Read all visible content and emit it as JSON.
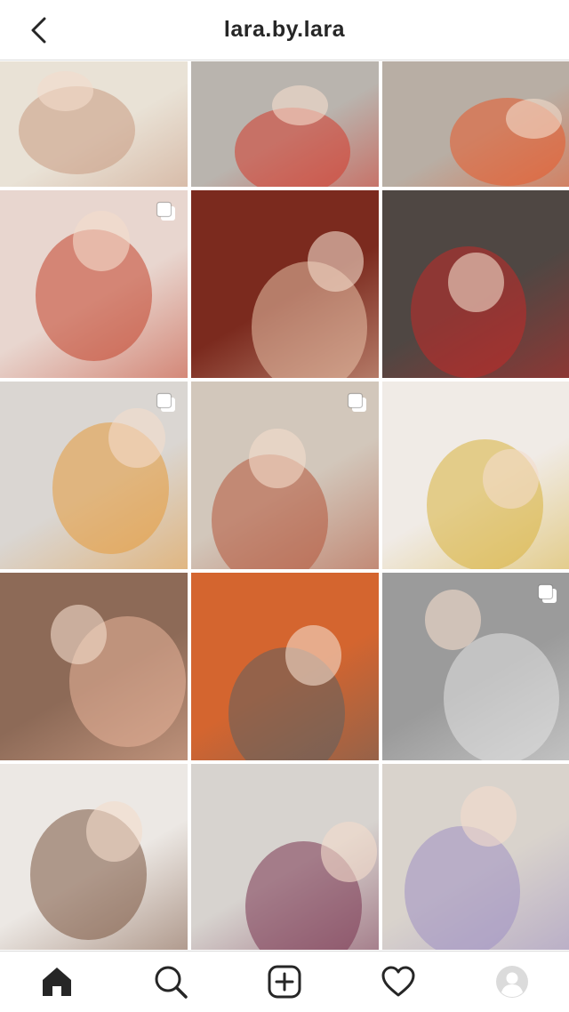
{
  "header": {
    "title": "lara.by.lara",
    "back_icon": "chevron-left-icon"
  },
  "grid": {
    "tiles": [
      {
        "name": "photo-baby-fleece",
        "bg": "#e9e2d6",
        "accent": "#c99b82",
        "multi": false
      },
      {
        "name": "photo-kids-floor",
        "bg": "#b9b4ae",
        "accent": "#d33a2c",
        "multi": false
      },
      {
        "name": "photo-couple-selfie",
        "bg": "#b8aea4",
        "accent": "#e85a2a",
        "multi": false
      },
      {
        "name": "photo-mother-babywrap",
        "bg": "#e8d6cf",
        "accent": "#c2432c",
        "multi": true
      },
      {
        "name": "photo-baby-sleeping-red",
        "bg": "#7b2a1e",
        "accent": "#e7c1a8",
        "multi": false
      },
      {
        "name": "photo-mother-daughter",
        "bg": "#4f4743",
        "accent": "#c22a28",
        "multi": false
      },
      {
        "name": "photo-birthday-girl-cake",
        "bg": "#dad6d2",
        "accent": "#e59a3a",
        "multi": true
      },
      {
        "name": "photo-man-birthday-table",
        "bg": "#d2c7bb",
        "accent": "#b4553a",
        "multi": true
      },
      {
        "name": "photo-balloon-three",
        "bg": "#f0ebe6",
        "accent": "#d8b23d",
        "multi": false
      },
      {
        "name": "photo-girl-crying",
        "bg": "#8d6a57",
        "accent": "#e9b59a",
        "multi": false
      },
      {
        "name": "photo-baby-orange-blanket",
        "bg": "#d4652f",
        "accent": "#5f6060",
        "multi": false
      },
      {
        "name": "photo-family-bw",
        "bg": "#9b9b9b",
        "accent": "#e4e4e4",
        "multi": true
      },
      {
        "name": "photo-girl-white-wall",
        "bg": "#ece8e4",
        "accent": "#7b5540",
        "multi": false
      },
      {
        "name": "photo-kids-highchairs",
        "bg": "#d7d3cf",
        "accent": "#7a3550",
        "multi": false
      },
      {
        "name": "photo-baby-lilac-knit",
        "bg": "#d9d3cc",
        "accent": "#9e8fc2",
        "multi": false
      }
    ]
  },
  "nav": {
    "home_icon": "home-icon",
    "search_icon": "search-icon",
    "add_icon": "add-post-icon",
    "activity_icon": "heart-icon",
    "profile_icon": "profile-avatar-icon"
  }
}
